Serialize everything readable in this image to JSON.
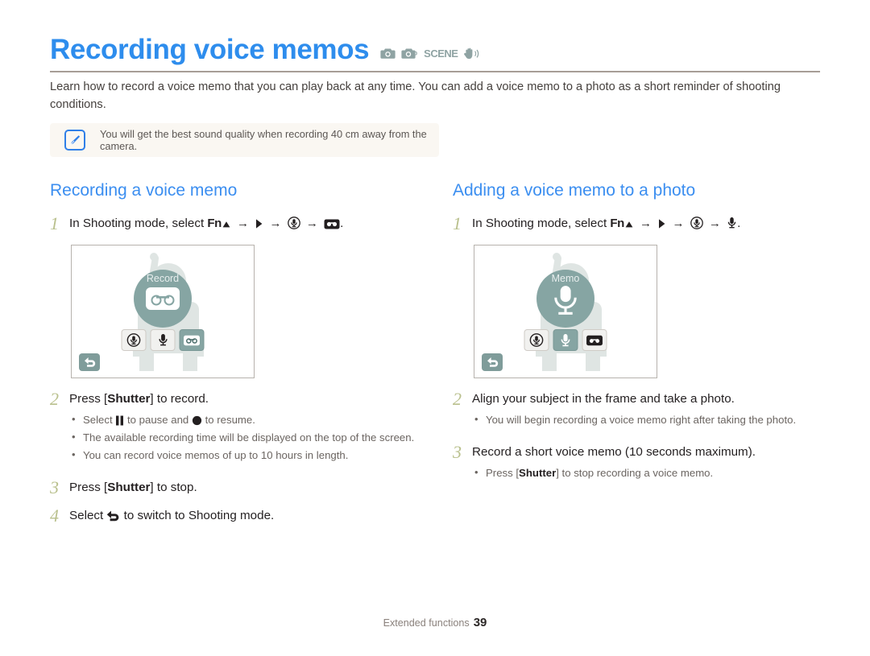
{
  "title": {
    "text": "Recording voice memos",
    "mode_icons": [
      "camera-auto-icon",
      "camera-program-icon",
      "scene-icon",
      "palm-dis-icon"
    ],
    "scene_label": "SCENE",
    "color": "#2e8ded"
  },
  "intro": "Learn how to record a voice memo that you can play back at any time. You can add a voice memo to a photo as a short reminder of shooting conditions.",
  "note": {
    "icon": "note-pen-icon",
    "text": "You will get the best sound quality when recording 40 cm away from the camera.",
    "background": "#faf7f2",
    "icon_color": "#2f7fe8"
  },
  "left_column": {
    "heading": "Recording a voice memo",
    "step1": {
      "num": "1",
      "prefix": "In Shooting mode, select",
      "fn_label": "Fn",
      "seq_icons": [
        "up-arrow-icon",
        "chevron-right-icon",
        "voice-recognition-icon",
        "voice-memo-tape-icon"
      ],
      "suffix": "."
    },
    "screen": {
      "caption": "Record",
      "center_icon": "voice-memo-tape-icon",
      "bottom_icons": [
        "voice-recognition-icon",
        "microphone-icon",
        "voice-memo-tape-icon"
      ],
      "selected_index": 2,
      "back_icon": "back-arrow-icon"
    },
    "step2": {
      "num": "2",
      "text_before": "Press [",
      "bold": "Shutter",
      "text_after": "] to record.",
      "bullets": [
        {
          "before": "Select ",
          "icon1": "pause-icon",
          "mid": " to pause and ",
          "icon2": "record-dot-icon",
          "after": " to resume."
        },
        {
          "text": "The available recording time will be displayed on the top of the screen."
        },
        {
          "text": "You can record voice memos of up to 10 hours in length."
        }
      ]
    },
    "step3": {
      "num": "3",
      "text_before": "Press [",
      "bold": "Shutter",
      "text_after": "] to stop."
    },
    "step4": {
      "num": "4",
      "text_before": "Select ",
      "icon": "back-arrow-icon",
      "text_after": " to switch to Shooting mode."
    }
  },
  "right_column": {
    "heading": "Adding a voice memo to a photo",
    "step1": {
      "num": "1",
      "prefix": "In Shooting mode, select",
      "fn_label": "Fn",
      "seq_icons": [
        "up-arrow-icon",
        "chevron-right-icon",
        "voice-recognition-icon",
        "microphone-icon"
      ],
      "suffix": "."
    },
    "screen": {
      "caption": "Memo",
      "center_icon": "microphone-icon",
      "bottom_icons": [
        "voice-recognition-icon",
        "microphone-icon",
        "voice-memo-tape-icon"
      ],
      "selected_index": 1,
      "back_icon": "back-arrow-icon"
    },
    "step2": {
      "num": "2",
      "text": "Align your subject in the frame and take a photo.",
      "bullets": [
        {
          "text": "You will begin recording a voice memo right after taking the photo."
        }
      ]
    },
    "step3": {
      "num": "3",
      "text": "Record a short voice memo (10 seconds maximum).",
      "bullets": [
        {
          "before": "Press [",
          "bold": "Shutter",
          "after": "] to stop recording a voice memo."
        }
      ]
    }
  },
  "footer": {
    "section": "Extended functions",
    "page": "39"
  }
}
